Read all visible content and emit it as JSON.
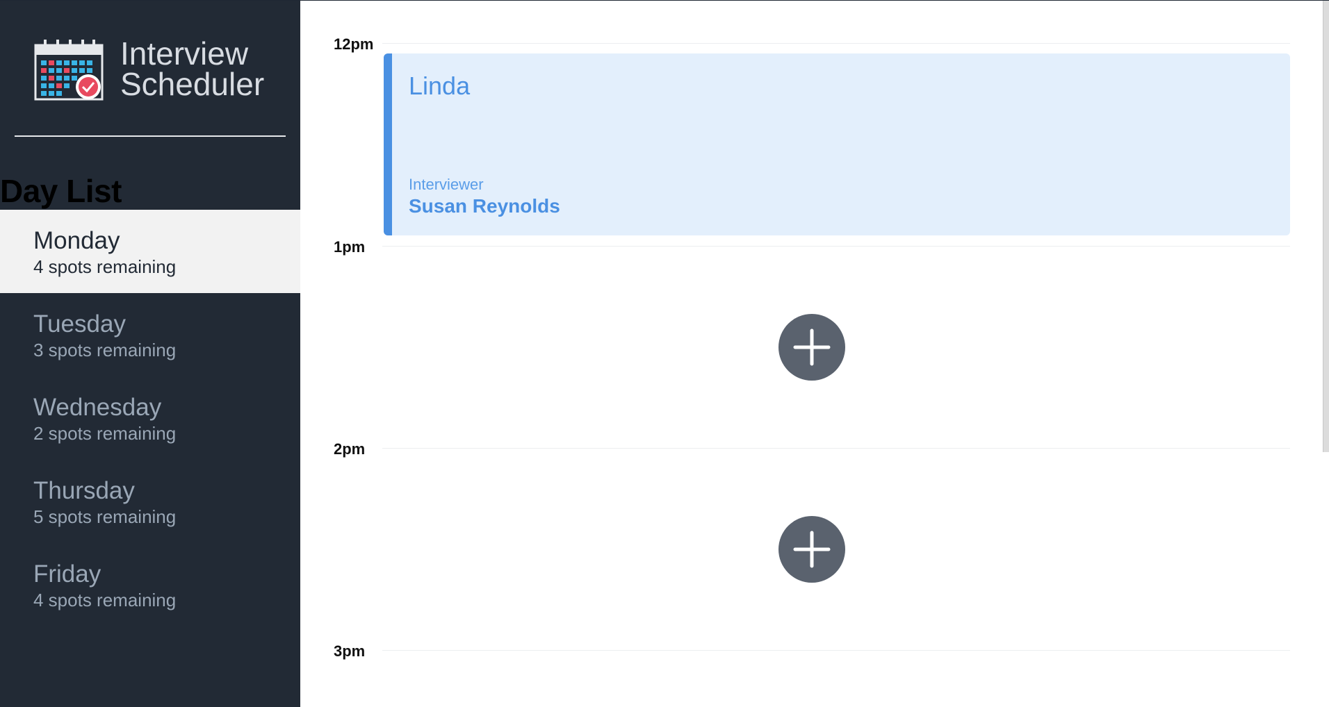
{
  "app": {
    "title_line1": "Interview",
    "title_line2": "Scheduler"
  },
  "sidebar": {
    "heading": "Day List",
    "days": [
      {
        "name": "Monday",
        "spots": "4 spots remaining",
        "selected": true
      },
      {
        "name": "Tuesday",
        "spots": "3 spots remaining",
        "selected": false
      },
      {
        "name": "Wednesday",
        "spots": "2 spots remaining",
        "selected": false
      },
      {
        "name": "Thursday",
        "spots": "5 spots remaining",
        "selected": false
      },
      {
        "name": "Friday",
        "spots": "4 spots remaining",
        "selected": false
      }
    ]
  },
  "schedule": {
    "times": [
      "12pm",
      "1pm",
      "2pm",
      "3pm"
    ],
    "appointment": {
      "student": "Linda",
      "interviewer_label": "Interviewer",
      "interviewer": "Susan Reynolds"
    }
  },
  "colors": {
    "sidebar_bg": "#222a35",
    "accent": "#4a90e2",
    "appointment_bg": "#e3effc",
    "add_button": "#5a626e"
  },
  "icons": {
    "logo": "calendar-check-icon",
    "add": "plus-icon"
  }
}
